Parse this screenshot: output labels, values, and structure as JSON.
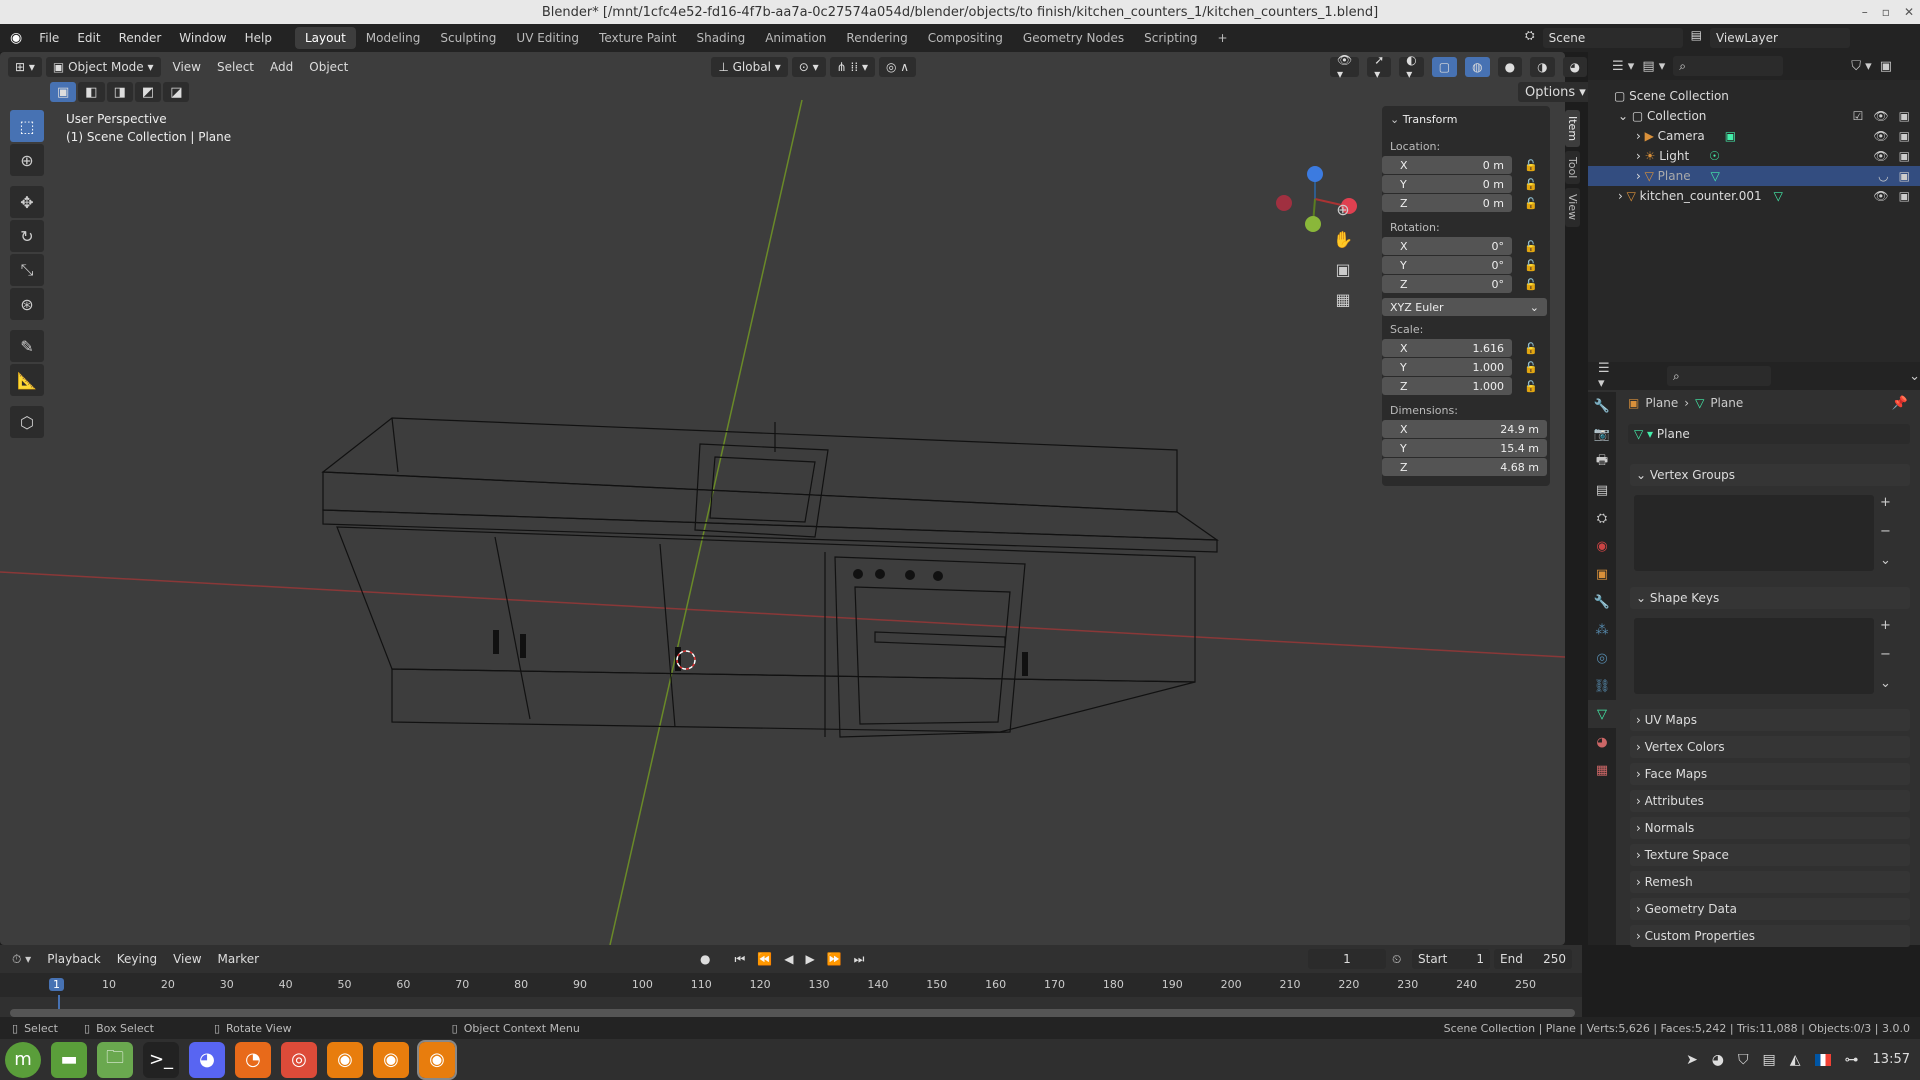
{
  "title": "Blender* [/mnt/1cfc4e52-fd16-4f7b-aa7a-0c27574a054d/blender/objects/to finish/kitchen_counters_1/kitchen_counters_1.blend]",
  "menu": [
    "File",
    "Edit",
    "Render",
    "Window",
    "Help"
  ],
  "workspaces": [
    "Layout",
    "Modeling",
    "Sculpting",
    "UV Editing",
    "Texture Paint",
    "Shading",
    "Animation",
    "Rendering",
    "Compositing",
    "Geometry Nodes",
    "Scripting"
  ],
  "scene": "Scene",
  "viewlayer": "ViewLayer",
  "vp": {
    "mode": "Object Mode",
    "menus": [
      "View",
      "Select",
      "Add",
      "Object"
    ],
    "orientation": "Global",
    "options": "Options",
    "info1": "User Perspective",
    "info2": "(1) Scene Collection | Plane"
  },
  "npanel": {
    "tabs": [
      "Item",
      "Tool",
      "View"
    ],
    "header": "Transform",
    "location": "Location:",
    "rotation": "Rotation:",
    "scale": "Scale:",
    "dimensions": "Dimensions:",
    "euler": "XYZ Euler",
    "loc": [
      {
        "a": "X",
        "v": "0 m"
      },
      {
        "a": "Y",
        "v": "0 m"
      },
      {
        "a": "Z",
        "v": "0 m"
      }
    ],
    "rot": [
      {
        "a": "X",
        "v": "0°"
      },
      {
        "a": "Y",
        "v": "0°"
      },
      {
        "a": "Z",
        "v": "0°"
      }
    ],
    "scl": [
      {
        "a": "X",
        "v": "1.616"
      },
      {
        "a": "Y",
        "v": "1.000"
      },
      {
        "a": "Z",
        "v": "1.000"
      }
    ],
    "dim": [
      {
        "a": "X",
        "v": "24.9 m"
      },
      {
        "a": "Y",
        "v": "15.4 m"
      },
      {
        "a": "Z",
        "v": "4.68 m"
      }
    ]
  },
  "outliner": {
    "root": "Scene Collection",
    "collection": "Collection",
    "items": [
      "Camera",
      "Light",
      "Plane",
      "kitchen_counter.001"
    ]
  },
  "props": {
    "crumb1": "Plane",
    "crumb2": "Plane",
    "mesh": "Plane",
    "vertex_groups": "Vertex Groups",
    "shape_keys": "Shape Keys",
    "sections": [
      "UV Maps",
      "Vertex Colors",
      "Face Maps",
      "Attributes",
      "Normals",
      "Texture Space",
      "Remesh",
      "Geometry Data",
      "Custom Properties"
    ]
  },
  "timeline": {
    "menus": [
      "Playback",
      "Keying",
      "View",
      "Marker"
    ],
    "frame": "1",
    "start_label": "Start",
    "start": "1",
    "end_label": "End",
    "end": "250",
    "ticks": [
      "1",
      "10",
      "20",
      "30",
      "40",
      "50",
      "60",
      "70",
      "80",
      "90",
      "100",
      "110",
      "120",
      "130",
      "140",
      "150",
      "160",
      "170",
      "180",
      "190",
      "200",
      "210",
      "220",
      "230",
      "240",
      "250"
    ]
  },
  "status": {
    "select": "Select",
    "box": "Box Select",
    "rotate": "Rotate View",
    "ctx": "Object Context Menu",
    "stats": "Scene Collection | Plane | Verts:5,626 | Faces:5,242 | Tris:11,088 | Objects:0/3 | 3.0.0"
  },
  "clock": "13:57"
}
